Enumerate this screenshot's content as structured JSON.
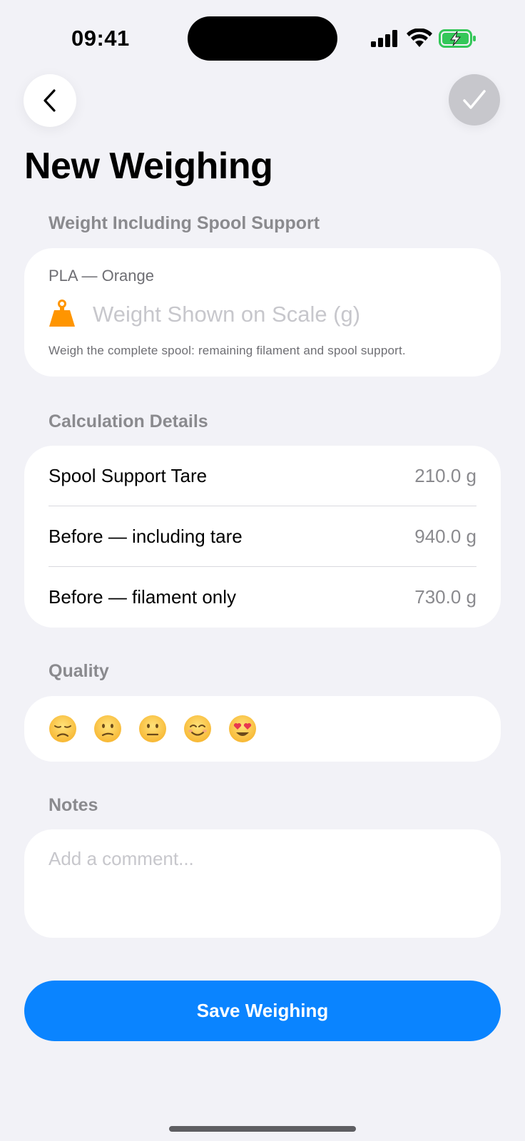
{
  "status_bar": {
    "time": "09:41",
    "icons": [
      "cellular-signal-icon",
      "wifi-icon",
      "battery-charging-icon"
    ]
  },
  "nav": {
    "back_icon": "chevron-left-icon",
    "done_icon": "checkmark-icon"
  },
  "page": {
    "title": "New Weighing"
  },
  "weight_section": {
    "header": "Weight Including Spool Support",
    "material": "PLA — Orange",
    "icon": "scale-weight-icon",
    "input_value": "",
    "input_placeholder": "Weight Shown on Scale (g)",
    "hint": "Weigh the complete spool: remaining filament and spool support."
  },
  "calculation": {
    "header": "Calculation Details",
    "rows": [
      {
        "label": "Spool Support Tare",
        "value": "210.0 g"
      },
      {
        "label": "Before — including tare",
        "value": "940.0 g"
      },
      {
        "label": "Before — filament only",
        "value": "730.0 g"
      }
    ]
  },
  "quality": {
    "header": "Quality",
    "options": [
      {
        "icon": "disappointed-face-icon"
      },
      {
        "icon": "confused-face-icon"
      },
      {
        "icon": "neutral-face-icon"
      },
      {
        "icon": "smiling-face-icon"
      },
      {
        "icon": "heart-eyes-face-icon"
      }
    ],
    "selected": null
  },
  "notes": {
    "header": "Notes",
    "value": "",
    "placeholder": "Add a comment..."
  },
  "actions": {
    "save_label": "Save Weighing"
  },
  "colors": {
    "background": "#f2f2f7",
    "card": "#ffffff",
    "accent": "#0a84ff",
    "secondary_text": "#8a8a8e",
    "placeholder": "#c7c7cc",
    "disabled_button": "#c7c7cc",
    "battery_green": "#34c759",
    "scale_orange": "#ff9500"
  }
}
